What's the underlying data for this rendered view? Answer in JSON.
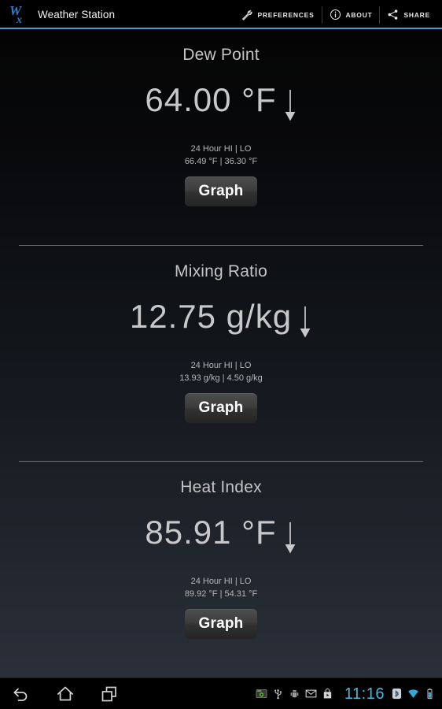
{
  "app": {
    "title": "Weather Station",
    "logo_icon": "wx-logo-icon",
    "accent_color": "#3f9bd4"
  },
  "action_bar": {
    "items": [
      {
        "label": "PREFERENCES",
        "icon": "wrench-icon"
      },
      {
        "label": "ABOUT",
        "icon": "info-circle-icon"
      },
      {
        "label": "SHARE",
        "icon": "share-icon"
      }
    ]
  },
  "panels": [
    {
      "title": "Dew Point",
      "value": "64.00 °F",
      "trend": "down",
      "trend_icon": "arrow-down-icon",
      "hilo_label": "24 Hour HI | LO",
      "hilo_values": "66.49 °F | 36.30 °F",
      "button_label": "Graph"
    },
    {
      "title": "Mixing Ratio",
      "value": "12.75 g/kg",
      "trend": "down",
      "trend_icon": "arrow-down-icon",
      "hilo_label": "24 Hour HI | LO",
      "hilo_values": "13.93 g/kg | 4.50 g/kg",
      "button_label": "Graph"
    },
    {
      "title": "Heat Index",
      "value": "85.91 °F",
      "trend": "down",
      "trend_icon": "arrow-down-icon",
      "hilo_label": "24 Hour HI | LO",
      "hilo_values": "89.92 °F | 54.31 °F",
      "button_label": "Graph"
    }
  ],
  "nav_bar": {
    "buttons": [
      {
        "name": "back-icon"
      },
      {
        "name": "home-icon"
      },
      {
        "name": "recents-icon"
      }
    ],
    "status_icons": [
      "screenshot-icon",
      "usb-icon",
      "android-debug-icon",
      "gmail-icon",
      "play-store-icon"
    ],
    "clock": "11:16",
    "right_icons": [
      "bluetooth-icon",
      "wifi-icon",
      "battery-icon"
    ],
    "clock_color": "#49b6e0"
  }
}
